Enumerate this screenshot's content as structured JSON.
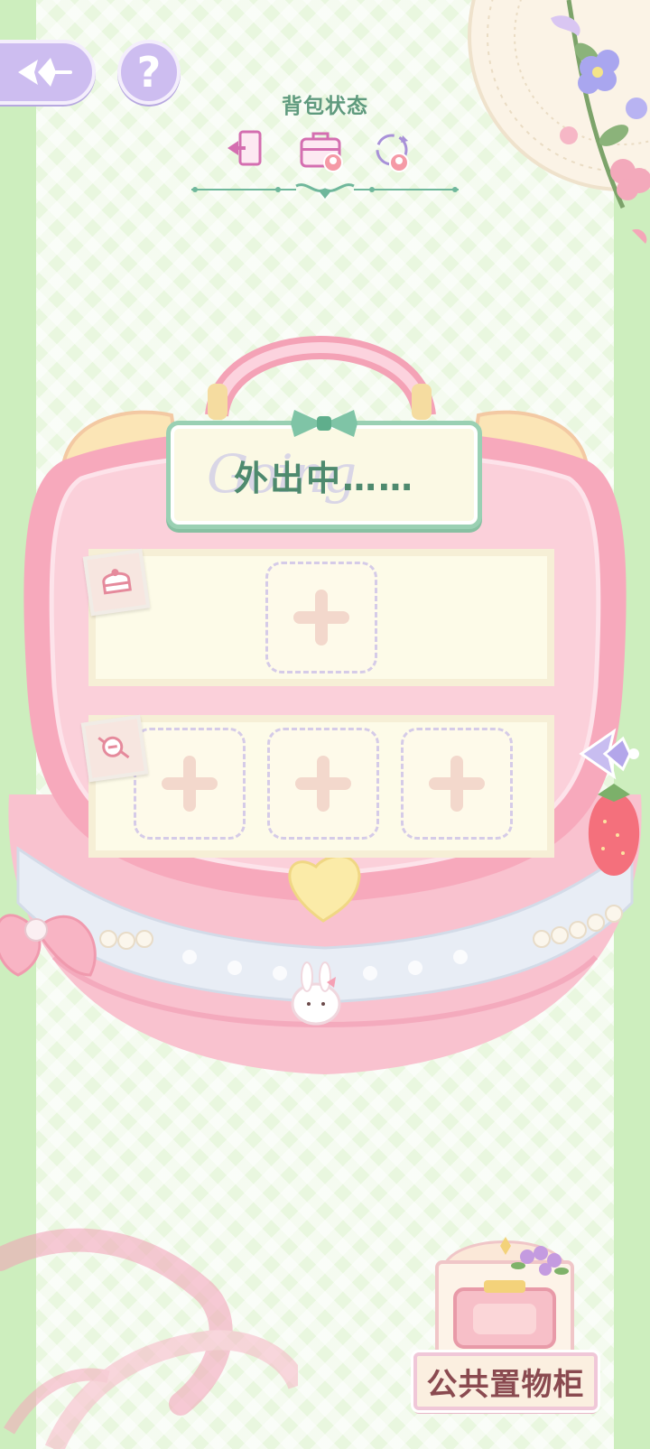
{
  "header": {
    "title": "背包状态",
    "icons": [
      "exit-door-icon",
      "briefcase-icon",
      "refresh-cycle-icon"
    ]
  },
  "buttons": {
    "back_icon": "sparkle-arrow-icon",
    "help_label": "?"
  },
  "bag": {
    "status_label": "外出中……",
    "watermark": "Going",
    "rows": [
      {
        "tag_icon": "cake-icon",
        "slots": 1
      },
      {
        "tag_icon": "candy-icon",
        "slots": 3
      }
    ]
  },
  "cabinet": {
    "label": "公共置物柜"
  },
  "colors": {
    "accent_green": "#5f9a7e",
    "bag_pink": "#f7b7c6",
    "button_purple": "#cdbdf0"
  }
}
